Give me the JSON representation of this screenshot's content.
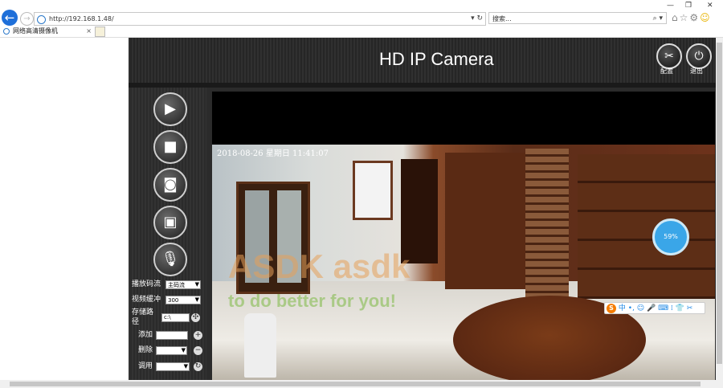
{
  "browser": {
    "url": "http://192.168.1.48/",
    "url_controls": "▾ ↻",
    "search_placeholder": "搜索...",
    "search_controls": "⌕ ▾",
    "window_min": "—",
    "window_max": "❐",
    "window_close": "✕",
    "tab_title": "网络高清摄像机",
    "tab_close": "×"
  },
  "header": {
    "title": "HD IP Camera",
    "config_label": "配置",
    "logout_label": "退出"
  },
  "controls": {
    "stream_label": "播放码流",
    "stream_value": "主码流",
    "buffer_label": "视频缓冲",
    "buffer_value": "300",
    "storage_label": "存储路径",
    "storage_value": "c:\\",
    "add_label": "添加",
    "delete_label": "删除",
    "call_label": "调用"
  },
  "video": {
    "osd_timestamp": "2018-08-26 星期日 11:41:07",
    "watermark_line1": "ASDK asdk",
    "watermark_line2": "to do better for you!",
    "badge_text": "59%"
  },
  "ime": {
    "logo": "S",
    "text": "中 •, ☺ 🎤 ⌨ ⁞ 👕 ✂"
  },
  "colors": {
    "browser_back": "#1e6fd9",
    "app_background": "#2b2b2b",
    "ime_accent": "#f57c00"
  }
}
